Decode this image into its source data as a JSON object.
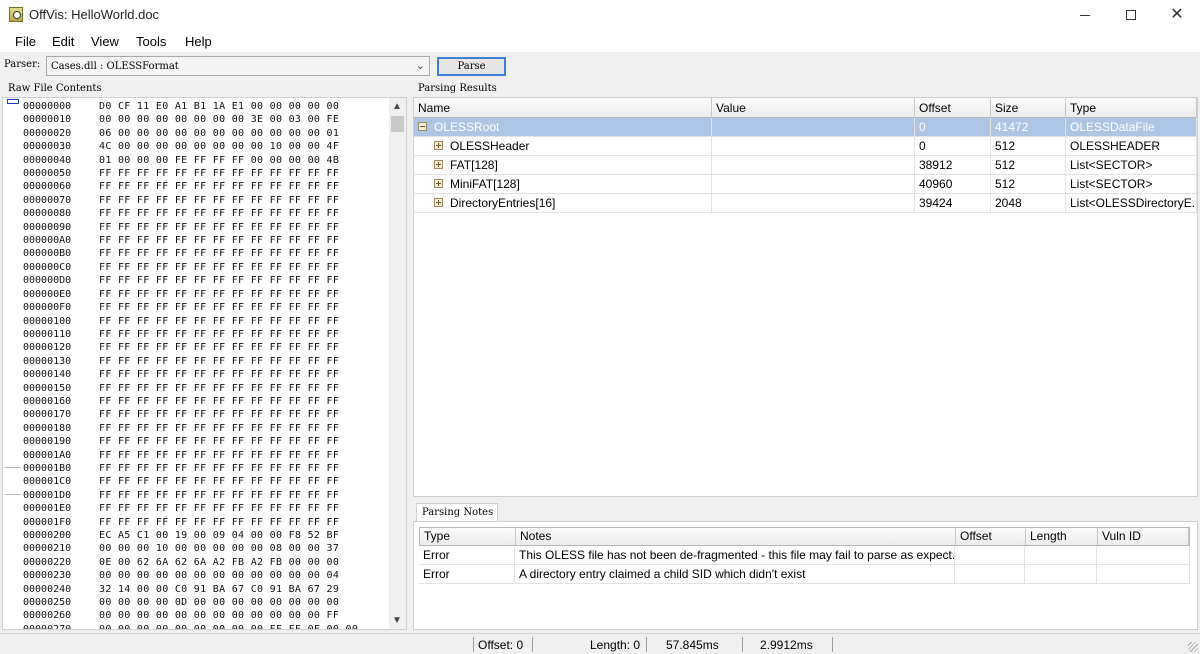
{
  "window": {
    "title": "OffVis: HelloWorld.doc",
    "minimize": "—",
    "maximize": "☐",
    "close": "✕"
  },
  "menu": [
    "File",
    "Edit",
    "View",
    "Tools",
    "Help"
  ],
  "parser": {
    "label": "Parser:",
    "selected": "Cases.dll : OLESSFormat",
    "parse_button": "Parse"
  },
  "raw": {
    "label": "Raw File Contents",
    "rows": [
      {
        "offset": "00000000",
        "bytes": "D0 CF 11 E0 A1 B1 1A E1 00 00 00 00 00"
      },
      {
        "offset": "00000010",
        "bytes": "00 00 00 00 00 00 00 00 3E 00 03 00 FE"
      },
      {
        "offset": "00000020",
        "bytes": "06 00 00 00 00 00 00 00 00 00 00 00 01"
      },
      {
        "offset": "00000030",
        "bytes": "4C 00 00 00 00 00 00 00 00 10 00 00 4F"
      },
      {
        "offset": "00000040",
        "bytes": "01 00 00 00 FE FF FF FF 00 00 00 00 4B"
      },
      {
        "offset": "00000050",
        "bytes": "FF FF FF FF FF FF FF FF FF FF FF FF FF"
      },
      {
        "offset": "00000060",
        "bytes": "FF FF FF FF FF FF FF FF FF FF FF FF FF"
      },
      {
        "offset": "00000070",
        "bytes": "FF FF FF FF FF FF FF FF FF FF FF FF FF"
      },
      {
        "offset": "00000080",
        "bytes": "FF FF FF FF FF FF FF FF FF FF FF FF FF"
      },
      {
        "offset": "00000090",
        "bytes": "FF FF FF FF FF FF FF FF FF FF FF FF FF"
      },
      {
        "offset": "000000A0",
        "bytes": "FF FF FF FF FF FF FF FF FF FF FF FF FF"
      },
      {
        "offset": "000000B0",
        "bytes": "FF FF FF FF FF FF FF FF FF FF FF FF FF"
      },
      {
        "offset": "000000C0",
        "bytes": "FF FF FF FF FF FF FF FF FF FF FF FF FF"
      },
      {
        "offset": "000000D0",
        "bytes": "FF FF FF FF FF FF FF FF FF FF FF FF FF"
      },
      {
        "offset": "000000E0",
        "bytes": "FF FF FF FF FF FF FF FF FF FF FF FF FF"
      },
      {
        "offset": "000000F0",
        "bytes": "FF FF FF FF FF FF FF FF FF FF FF FF FF"
      },
      {
        "offset": "00000100",
        "bytes": "FF FF FF FF FF FF FF FF FF FF FF FF FF"
      },
      {
        "offset": "00000110",
        "bytes": "FF FF FF FF FF FF FF FF FF FF FF FF FF"
      },
      {
        "offset": "00000120",
        "bytes": "FF FF FF FF FF FF FF FF FF FF FF FF FF"
      },
      {
        "offset": "00000130",
        "bytes": "FF FF FF FF FF FF FF FF FF FF FF FF FF"
      },
      {
        "offset": "00000140",
        "bytes": "FF FF FF FF FF FF FF FF FF FF FF FF FF"
      },
      {
        "offset": "00000150",
        "bytes": "FF FF FF FF FF FF FF FF FF FF FF FF FF"
      },
      {
        "offset": "00000160",
        "bytes": "FF FF FF FF FF FF FF FF FF FF FF FF FF"
      },
      {
        "offset": "00000170",
        "bytes": "FF FF FF FF FF FF FF FF FF FF FF FF FF"
      },
      {
        "offset": "00000180",
        "bytes": "FF FF FF FF FF FF FF FF FF FF FF FF FF"
      },
      {
        "offset": "00000190",
        "bytes": "FF FF FF FF FF FF FF FF FF FF FF FF FF"
      },
      {
        "offset": "000001A0",
        "bytes": "FF FF FF FF FF FF FF FF FF FF FF FF FF"
      },
      {
        "offset": "000001B0",
        "bytes": "FF FF FF FF FF FF FF FF FF FF FF FF FF"
      },
      {
        "offset": "000001C0",
        "bytes": "FF FF FF FF FF FF FF FF FF FF FF FF FF"
      },
      {
        "offset": "000001D0",
        "bytes": "FF FF FF FF FF FF FF FF FF FF FF FF FF"
      },
      {
        "offset": "000001E0",
        "bytes": "FF FF FF FF FF FF FF FF FF FF FF FF FF"
      },
      {
        "offset": "000001F0",
        "bytes": "FF FF FF FF FF FF FF FF FF FF FF FF FF"
      },
      {
        "offset": "00000200",
        "bytes": "EC A5 C1 00 19 00 09 04 00 00 F8 52 BF"
      },
      {
        "offset": "00000210",
        "bytes": "00 00 00 10 00 00 00 00 00 08 00 00 37"
      },
      {
        "offset": "00000220",
        "bytes": "0E 00 62 6A 62 6A A2 FB A2 FB 00 00 00"
      },
      {
        "offset": "00000230",
        "bytes": "00 00 00 00 00 00 00 00 00 00 00 00 04"
      },
      {
        "offset": "00000240",
        "bytes": "32 14 00 00 C0 91 BA 67 C0 91 BA 67 29"
      },
      {
        "offset": "00000250",
        "bytes": "00 00 00 00 0D 00 00 00 00 00 00 00 00"
      },
      {
        "offset": "00000260",
        "bytes": "00 00 00 00 00 00 00 00 00 00 00 00 FF"
      },
      {
        "offset": "00000270",
        "bytes": "00 00 00 00 00 00 00 00 00 FF FF 0F 00 00"
      }
    ]
  },
  "results": {
    "label": "Parsing Results",
    "columns": [
      "Name",
      "Value",
      "Offset",
      "Size",
      "Type"
    ],
    "rows": [
      {
        "name": "OLESSRoot",
        "value": "",
        "offset": "0",
        "size": "41472",
        "type": "OLESSDataFile"
      },
      {
        "name": "OLESSHeader",
        "value": "",
        "offset": "0",
        "size": "512",
        "type": "OLESSHEADER"
      },
      {
        "name": "FAT[128]",
        "value": "",
        "offset": "38912",
        "size": "512",
        "type": "List<SECTOR>"
      },
      {
        "name": "MiniFAT[128]",
        "value": "",
        "offset": "40960",
        "size": "512",
        "type": "List<SECTOR>"
      },
      {
        "name": "DirectoryEntries[16]",
        "value": "",
        "offset": "39424",
        "size": "2048",
        "type": "List<OLESSDirectoryE..."
      }
    ]
  },
  "notes": {
    "tab": "Parsing Notes",
    "columns": [
      "Type",
      "Notes",
      "Offset",
      "Length",
      "Vuln ID"
    ],
    "rows": [
      {
        "type": "Error",
        "notes": "This OLESS file has not been de-fragmented - this file may fail to parse as expect...",
        "offset": "",
        "length": "",
        "vuln": ""
      },
      {
        "type": "Error",
        "notes": "A directory entry claimed a child SID which didn't exist",
        "offset": "",
        "length": "",
        "vuln": ""
      }
    ]
  },
  "status": {
    "offset": "Offset: 0",
    "length": "Length: 0",
    "time1": "57.845ms",
    "time2": "2.9912ms"
  },
  "icons": {
    "up": "▲",
    "down": "▼",
    "select_arrow": "⌄"
  }
}
